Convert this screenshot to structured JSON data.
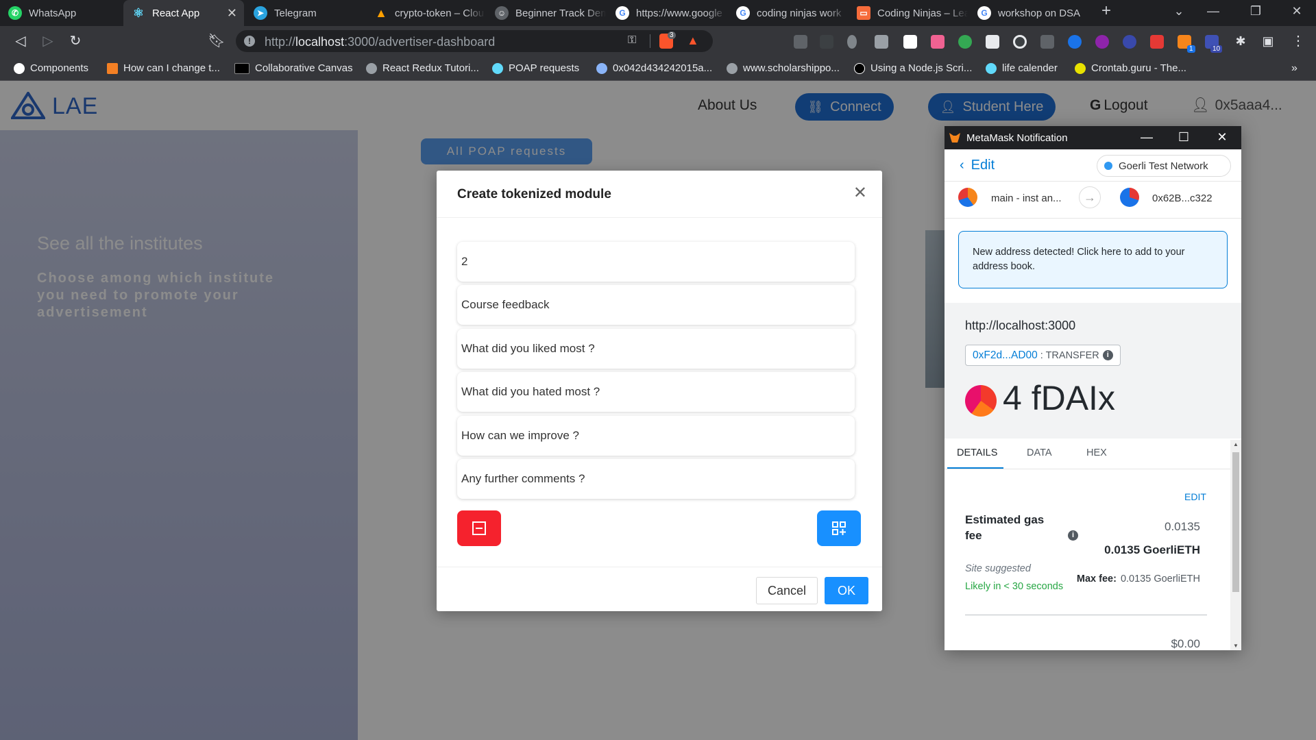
{
  "tabs": [
    {
      "label": "WhatsApp",
      "icon": "whatsapp-icon",
      "color": "#25d366"
    },
    {
      "label": "React App",
      "icon": "react-icon",
      "color": "#61dafb",
      "active": true
    },
    {
      "label": "Telegram",
      "icon": "telegram-icon",
      "color": "#2aa3df"
    },
    {
      "label": "crypto-token – Clou",
      "icon": "firebase-icon",
      "color": "#ffa000"
    },
    {
      "label": "Beginner Track Dem",
      "icon": "hacker-icon",
      "color": "#9aa0a6"
    },
    {
      "label": "https://www.google",
      "icon": "google-icon",
      "color": "#ffffff"
    },
    {
      "label": "coding ninjas work",
      "icon": "google-icon",
      "color": "#ffffff"
    },
    {
      "label": "Coding Ninjas – Lea",
      "icon": "coding-ninjas-icon",
      "color": "#f66c3b"
    },
    {
      "label": "workshop on DSA",
      "icon": "google-icon",
      "color": "#ffffff"
    }
  ],
  "browser": {
    "url_prefix": "http://",
    "url_host": "localhost",
    "url_path": ":3000/advertiser-dashboard",
    "brave_badge": "3"
  },
  "extension_badges": {
    "metamask": "1",
    "other": "10"
  },
  "bookmarks": [
    {
      "label": "Components",
      "icon": "github-icon",
      "color": "#ffffff"
    },
    {
      "label": "How can I change t...",
      "icon": "stackoverflow-icon",
      "color": "#f48024"
    },
    {
      "label": "Collaborative Canvas",
      "icon": "dev-icon",
      "color": "#000000"
    },
    {
      "label": "React Redux Tutori...",
      "icon": "globe-icon",
      "color": "#9aa0a6"
    },
    {
      "label": "POAP requests",
      "icon": "react-icon",
      "color": "#61dafb"
    },
    {
      "label": "0x042d434242015a...",
      "icon": "moon-icon",
      "color": "#8ab4f8"
    },
    {
      "label": "www.scholarshippo...",
      "icon": "globe-icon",
      "color": "#9aa0a6"
    },
    {
      "label": "Using a Node.js Scri...",
      "icon": "medium-icon",
      "color": "#000000"
    },
    {
      "label": "life calender",
      "icon": "react-icon",
      "color": "#61dafb"
    },
    {
      "label": "Crontab.guru - The...",
      "icon": "crontab-icon",
      "color": "#e8e200"
    }
  ],
  "app": {
    "brand": "LAE",
    "nav": {
      "about": "About Us",
      "connect": "Connect",
      "student": "Student Here",
      "logout": "Logout",
      "account": "0x5aaa4..."
    },
    "side_title": "See all the institutes",
    "side_subtitle": "Choose among which institute you need to promote your advertisement",
    "poap_button": "All POAP requests"
  },
  "modal": {
    "title": "Create tokenized module",
    "fields": [
      "2",
      "Course feedback",
      "What did you liked most ?",
      "What did you hated most ?",
      "How can we improve ?",
      "Any further comments ?"
    ],
    "cancel": "Cancel",
    "ok": "OK"
  },
  "metamask": {
    "window_title": "MetaMask Notification",
    "edit": "Edit",
    "network": "Goerli Test Network",
    "from_account": "main - inst an...",
    "to_account": "0x62B...c322",
    "alert": "New address detected! Click here to add to your address book.",
    "origin": "http://localhost:3000",
    "method_address": "0xF2d...AD00",
    "method_name": ": TRANSFER",
    "amount": "4 fDAIx",
    "tabs": [
      "DETAILS",
      "DATA",
      "HEX"
    ],
    "edit_link": "EDIT",
    "gas_label": "Estimated gas fee",
    "gas_value": "0.0135",
    "gas_value_bold": "0.0135 GoerliETH",
    "site_suggested": "Site suggested",
    "likely": "Likely in < 30 seconds",
    "max_fee_label": "Max fee:",
    "max_fee_value": "0.0135 GoerliETH",
    "total": "$0.00"
  },
  "colors": {
    "brand_blue": "#2f67c8",
    "primary": "#1890ff",
    "danger": "#f5222d",
    "metamask_blue": "#037dd6",
    "success": "#28a745"
  }
}
